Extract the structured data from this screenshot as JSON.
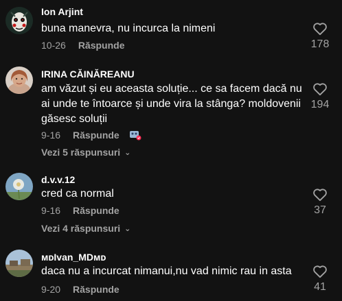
{
  "comments": [
    {
      "username": "Ion Arjint",
      "text": "buna manevra, nu incurca la nimeni",
      "date": "10-26",
      "reply_label": "Răspunde",
      "likes": "178",
      "avatar": "jigsaw-mask-avatar"
    },
    {
      "username": "IRINA CĂINĂREANU",
      "text": "am văzut și eu aceasta soluție... ce sa facem dacă nu ai unde te întoarce și unde vira la stânga? moldovenii găsesc soluții",
      "date": "9-16",
      "reply_label": "Răspunde",
      "likes": "194",
      "view_replies": "Vezi 5 răspunsuri",
      "avatar": "woman-portrait-avatar"
    },
    {
      "username": "d.v.v.12",
      "text": "cred ca normal",
      "date": "9-16",
      "reply_label": "Răspunde",
      "likes": "37",
      "view_replies": "Vezi 4 răspunsuri",
      "avatar": "dandelion-avatar"
    },
    {
      "username": "ᴍᴅIvan_MDᴍᴅ",
      "text": "daca nu a incurcat nimanui,nu vad nimic rau in asta",
      "date": "9-20",
      "reply_label": "Răspunde",
      "likes": "41",
      "avatar": "landscape-avatar"
    }
  ],
  "colors": {
    "background": "#121212",
    "muted": "#a3a3a3",
    "text": "#ffffff"
  }
}
